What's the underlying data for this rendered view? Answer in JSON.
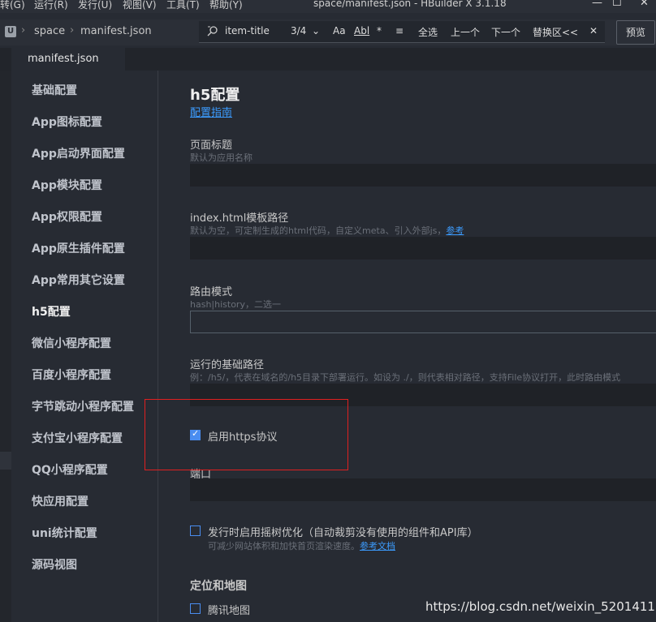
{
  "menubar": {
    "items": [
      "转(G)",
      "运行(R)",
      "发行(U)",
      "视图(V)",
      "工具(T)",
      "帮助(Y)"
    ],
    "title": "space/manifest.json - HBuilder X 3.1.18"
  },
  "toolbar": {
    "breadcrumb": [
      "space",
      "manifest.json"
    ],
    "find": {
      "query": "item-title",
      "count": "3/4",
      "case_label": "Aa",
      "word_label": "A͟b͟l",
      "regex_label": "*",
      "replace_toggle_label": "≡",
      "select_all": "全选",
      "prev": "上一个",
      "next": "下一个",
      "replace_area": "替换区<<",
      "close": "✕"
    },
    "preview": "预览"
  },
  "tab": {
    "label": "manifest.json"
  },
  "sidebar": {
    "items": [
      "基础配置",
      "App图标配置",
      "App启动界面配置",
      "App模块配置",
      "App权限配置",
      "App原生插件配置",
      "App常用其它设置",
      "h5配置",
      "微信小程序配置",
      "百度小程序配置",
      "字节跳动小程序配置",
      "支付宝小程序配置",
      "QQ小程序配置",
      "快应用配置",
      "uni统计配置",
      "源码视图"
    ],
    "active_index": 7
  },
  "main": {
    "title": "h5配置",
    "guide_link": "配置指南",
    "page_title_label": "页面标题",
    "page_title_hint": "默认为应用名称",
    "template_label": "index.html模板路径",
    "template_hint": "默认为空，可定制生成的html代码，自定义meta、引入外部js，",
    "template_hint_link": "参考",
    "router_label": "路由模式",
    "router_hint": "hash|history，二选一",
    "base_label": "运行的基础路径",
    "base_hint": "例：/h5/，代表在域名的/h5目录下部署运行。如设为 ./，则代表相对路径，支持File协议打开，此时路由模式",
    "https_label": "启用https协议",
    "https_checked": true,
    "port_label": "端口",
    "treeshake_label": "发行时启用摇树优化（自动裁剪没有使用的组件和API库）",
    "treeshake_checked": false,
    "treeshake_hint": "可减少网站体积和加快首页渲染速度。",
    "treeshake_link": "参考文档",
    "map_section": "定位和地图",
    "tencent_map_label": "腾讯地图",
    "tencent_map_checked": false
  },
  "watermark": "https://blog.csdn.net/weixin_52014110"
}
